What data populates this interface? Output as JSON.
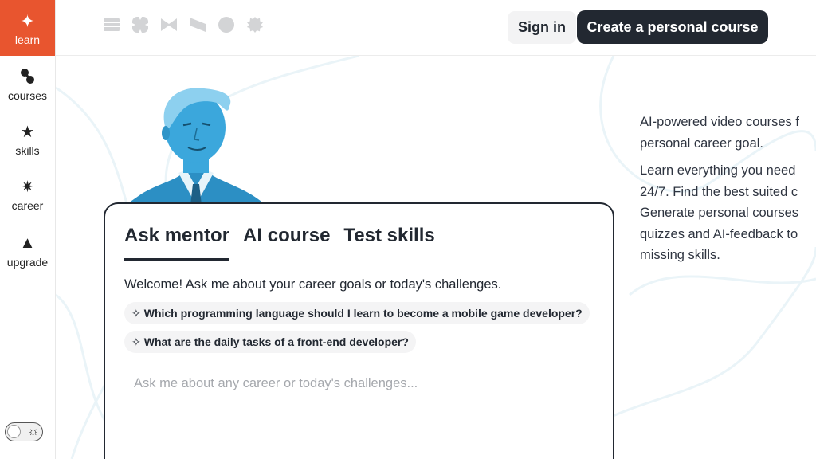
{
  "sidebar": {
    "learn": {
      "label": "learn",
      "icon": "sparkle-icon"
    },
    "items": [
      {
        "label": "courses",
        "icon": "courses-icon"
      },
      {
        "label": "skills",
        "icon": "star-icon"
      },
      {
        "label": "career",
        "icon": "burst-icon"
      },
      {
        "label": "upgrade",
        "icon": "triangle-up-icon"
      }
    ],
    "theme_toggle": {
      "icon": "sun-icon"
    },
    "accent_color": "#e8552f"
  },
  "header": {
    "signin_label": "Sign in",
    "create_label": "Create a personal course",
    "partner_logos": [
      "partner-logo-1",
      "partner-logo-2",
      "partner-logo-3",
      "partner-logo-4",
      "partner-logo-5",
      "partner-logo-6"
    ]
  },
  "card": {
    "tabs": [
      {
        "label": "Ask mentor",
        "active": true
      },
      {
        "label": "AI course",
        "active": false
      },
      {
        "label": "Test skills",
        "active": false
      }
    ],
    "welcome": "Welcome! Ask me about your career goals or today's challenges.",
    "suggestions": [
      "Which programming language should I learn to become a mobile game developer?",
      "What are the daily tasks of a front-end developer?"
    ],
    "input_placeholder": "Ask me about any career or today's challenges..."
  },
  "description": {
    "p1_lines": [
      "AI-powered video courses f",
      "personal career goal."
    ],
    "p2_lines": [
      "Learn everything you need",
      "24/7. Find the best suited c",
      "Generate personal courses",
      "quizzes and AI-feedback to",
      "missing skills."
    ]
  },
  "colors": {
    "dark": "#222831",
    "portrait_blue": "#3ba7dc"
  }
}
